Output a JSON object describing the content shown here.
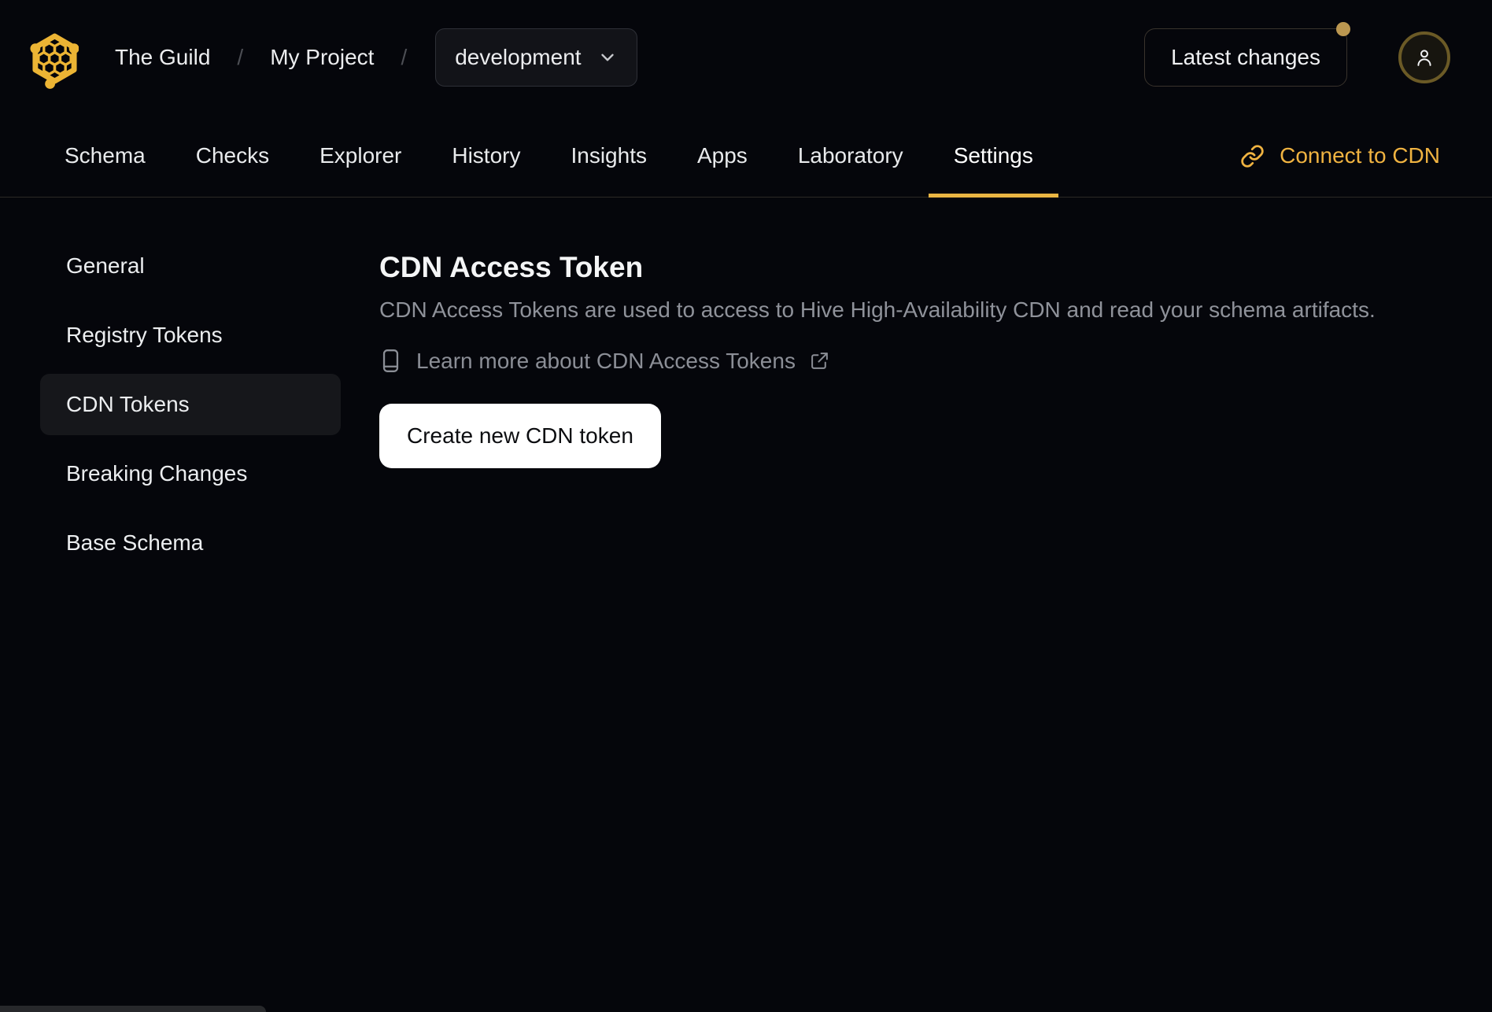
{
  "header": {
    "org_name": "The Guild",
    "breadcrumb_separator": "/",
    "project_name": "My Project",
    "target_selector": {
      "selected": "development"
    },
    "latest_changes_label": "Latest changes"
  },
  "nav": {
    "tabs": [
      {
        "label": "Schema",
        "active": false
      },
      {
        "label": "Checks",
        "active": false
      },
      {
        "label": "Explorer",
        "active": false
      },
      {
        "label": "History",
        "active": false
      },
      {
        "label": "Insights",
        "active": false
      },
      {
        "label": "Apps",
        "active": false
      },
      {
        "label": "Laboratory",
        "active": false
      },
      {
        "label": "Settings",
        "active": true
      }
    ],
    "connect_cdn_label": "Connect to CDN"
  },
  "sidebar": {
    "items": [
      {
        "label": "General",
        "active": false
      },
      {
        "label": "Registry Tokens",
        "active": false
      },
      {
        "label": "CDN Tokens",
        "active": true
      },
      {
        "label": "Breaking Changes",
        "active": false
      },
      {
        "label": "Base Schema",
        "active": false
      }
    ]
  },
  "main": {
    "title": "CDN Access Token",
    "description": "CDN Access Tokens are used to access to Hive High-Availability CDN and read your schema artifacts.",
    "learn_more_label": "Learn more about CDN Access Tokens",
    "create_token_label": "Create new CDN token"
  },
  "icons": {
    "logo": "hive-honeycomb-hexagon",
    "target_selector": "chevron-down",
    "connect_cdn": "link-chain",
    "learn_more_leading": "book",
    "learn_more_trailing": "external-link",
    "avatar": "person",
    "notification": "gold-dot"
  },
  "colors": {
    "background": "#05060b",
    "accent_gold": "#f0b341",
    "active_tab_underline": "#eab543",
    "logo_gold": "#ecb434",
    "notification_dot": "#bb9750",
    "avatar_ring": "#6b5a26",
    "muted_text": "#8f929a",
    "divider": "#2b2a26",
    "active_item_bg": "#16171b",
    "create_button_bg": "#ffffff"
  }
}
